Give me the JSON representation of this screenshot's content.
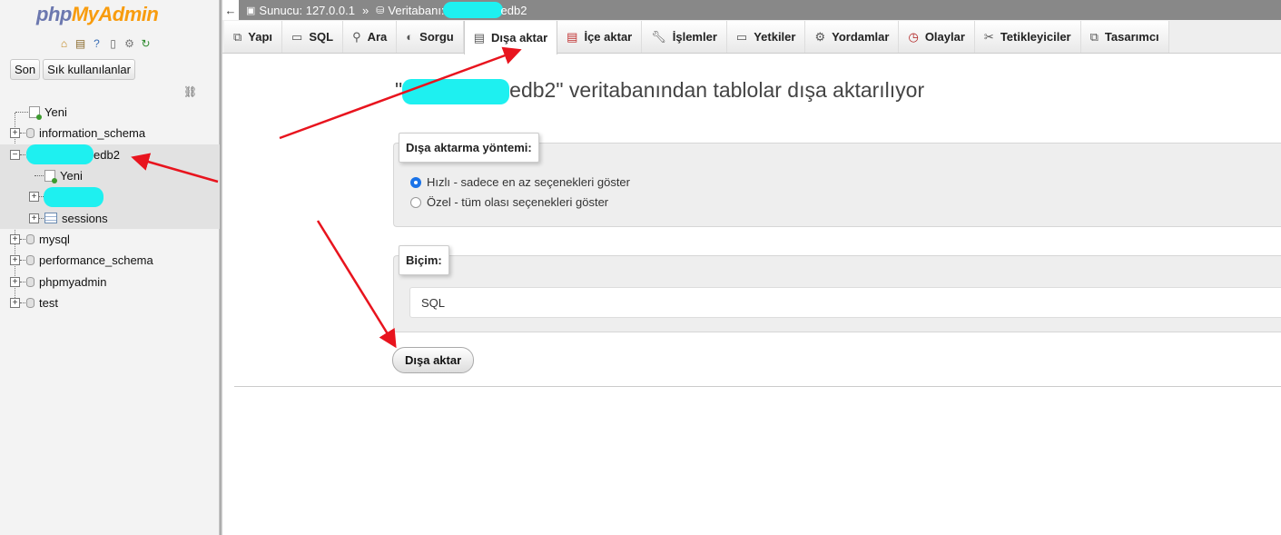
{
  "sidebar": {
    "logo_part1": "php",
    "logo_part2": "MyAdmin",
    "toolbar_icons": [
      "home-icon",
      "exit-icon",
      "help-icon",
      "docs-icon",
      "settings-icon",
      "reload-icon"
    ],
    "buttons": {
      "recent": "Son",
      "favorites": "Sık kullanılanlar"
    },
    "tree": {
      "new": "Yeni",
      "information_schema": "information_schema",
      "current_db_suffix": "edb2",
      "child_new": "Yeni",
      "sessions": "sessions",
      "mysql": "mysql",
      "performance_schema": "performance_schema",
      "phpmyadmin": "phpmyadmin",
      "test": "test"
    }
  },
  "breadcrumb": {
    "server": "Sunucu: 127.0.0.1",
    "separator": "»",
    "database_label": "Veritabanı:",
    "database_suffix": "edb2"
  },
  "tabs": [
    {
      "label": "Yapı",
      "icon": "structure-icon"
    },
    {
      "label": "SQL",
      "icon": "sql-icon"
    },
    {
      "label": "Ara",
      "icon": "search-icon"
    },
    {
      "label": "Sorgu",
      "icon": "query-icon"
    },
    {
      "label": "Dışa aktar",
      "icon": "export-icon",
      "active": true
    },
    {
      "label": "İçe aktar",
      "icon": "import-icon"
    },
    {
      "label": "İşlemler",
      "icon": "operations-icon"
    },
    {
      "label": "Yetkiler",
      "icon": "privileges-icon"
    },
    {
      "label": "Yordamlar",
      "icon": "routines-icon"
    },
    {
      "label": "Olaylar",
      "icon": "events-icon"
    },
    {
      "label": "Tetikleyiciler",
      "icon": "triggers-icon"
    },
    {
      "label": "Tasarımcı",
      "icon": "designer-icon"
    }
  ],
  "main": {
    "title_open": "\"",
    "title_db_suffix": "edb2",
    "title_rest": "\" veritabanından tablolar dışa aktarılıyor",
    "method": {
      "legend": "Dışa aktarma yöntemi:",
      "quick": "Hızlı - sadece en az seçenekleri göster",
      "custom": "Özel - tüm olası seçenekleri göster",
      "selected": "quick"
    },
    "format": {
      "legend": "Biçim:",
      "value": "SQL"
    },
    "submit_label": "Dışa aktar"
  },
  "colors": {
    "annotation_arrow": "#e8141e",
    "redaction": "#1ef0f0",
    "radio_selected": "#1a73e8"
  }
}
